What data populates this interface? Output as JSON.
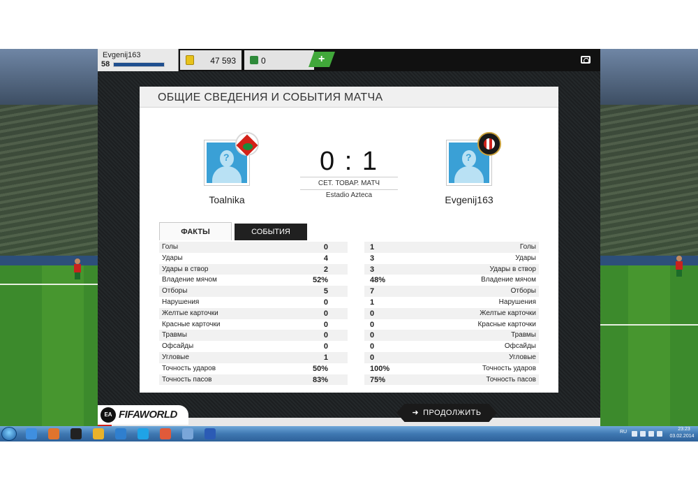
{
  "topbar": {
    "username": "Evgenij163",
    "level": "58",
    "coins": "47 593",
    "points": "0",
    "add_label": "+"
  },
  "card": {
    "title": "ОБЩИЕ СВЕДЕНИЯ И СОБЫТИЯ МАТЧА",
    "home_team": "Toalnika",
    "away_team": "Evgenij163",
    "score": "0 : 1",
    "match_type": "СЕТ. ТОВАР. МАТЧ",
    "stadium": "Estadio Azteca",
    "tabs": [
      "ФАКТЫ",
      "СОБЫТИЯ"
    ]
  },
  "stats": [
    {
      "name": "Голы",
      "home": "0",
      "away": "1"
    },
    {
      "name": "Удары",
      "home": "4",
      "away": "3"
    },
    {
      "name": "Удары в створ",
      "home": "2",
      "away": "3"
    },
    {
      "name": "Владение мячом",
      "home": "52%",
      "away": "48%"
    },
    {
      "name": "Отборы",
      "home": "5",
      "away": "7"
    },
    {
      "name": "Нарушения",
      "home": "0",
      "away": "1"
    },
    {
      "name": "Желтые карточки",
      "home": "0",
      "away": "0"
    },
    {
      "name": "Красные карточки",
      "home": "0",
      "away": "0"
    },
    {
      "name": "Травмы",
      "home": "0",
      "away": "0"
    },
    {
      "name": "Офсайды",
      "home": "0",
      "away": "0"
    },
    {
      "name": "Угловые",
      "home": "1",
      "away": "0"
    },
    {
      "name": "Точность ударов",
      "home": "50%",
      "away": "100%"
    },
    {
      "name": "Точность пасов",
      "home": "83%",
      "away": "75%"
    }
  ],
  "footer": {
    "continue_label": "ПРОДОЛЖИТЬ",
    "logo_text": "FIFAWORLD",
    "ea_text": "EA"
  },
  "taskbar": {
    "lang": "RU",
    "time": "23:23",
    "date": "03.02.2014",
    "apps": [
      "ie-icon",
      "media-player-icon",
      "terminal-icon",
      "chrome-icon",
      "fifa-world-icon",
      "skype-icon",
      "radio-icon",
      "search-tool-icon",
      "word-icon"
    ]
  },
  "colors": {
    "accent_green": "#41a83a",
    "dark": "#1a1a1a",
    "coin": "#e7c21b"
  }
}
